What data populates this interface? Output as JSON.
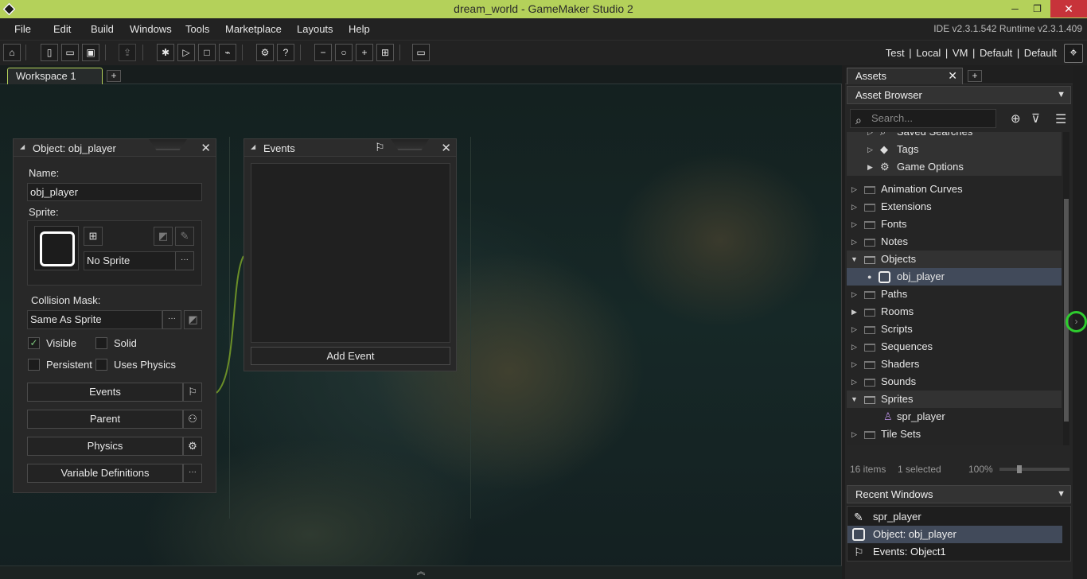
{
  "window": {
    "title": "dream_world - GameMaker Studio 2",
    "minimize": "─",
    "restore": "❐",
    "close": "✕"
  },
  "menu": {
    "items": [
      "File",
      "Edit",
      "Build",
      "Windows",
      "Tools",
      "Marketplace",
      "Layouts",
      "Help"
    ],
    "version": "IDE v2.3.1.542  Runtime v2.3.1.409"
  },
  "toolbar": {
    "target": "Test | Local | VM | Default | Default"
  },
  "workspace": {
    "tab": "Workspace 1",
    "add_tab": "+"
  },
  "object_editor": {
    "title": "Object: obj_player",
    "name_label": "Name:",
    "name_value": "obj_player",
    "sprite_label": "Sprite:",
    "sprite_value": "No Sprite",
    "mask_label": "Collision Mask:",
    "mask_value": "Same As Sprite",
    "more": "···",
    "checks": {
      "visible": "Visible",
      "solid": "Solid",
      "persistent": "Persistent",
      "physics": "Uses Physics"
    },
    "visible_checked": true,
    "buttons": {
      "events": "Events",
      "parent": "Parent",
      "physics": "Physics",
      "vars": "Variable Definitions"
    }
  },
  "events_editor": {
    "title": "Events",
    "add_event": "Add Event"
  },
  "assets": {
    "tab": "Assets",
    "add_tab": "+",
    "browser": "Asset Browser",
    "search_placeholder": "Search...",
    "tree": [
      {
        "label": "Saved Searches",
        "kind": "search"
      },
      {
        "label": "Tags",
        "kind": "tag"
      },
      {
        "label": "Game Options",
        "kind": "gear"
      },
      {
        "label": "Animation Curves",
        "kind": "folder"
      },
      {
        "label": "Extensions",
        "kind": "folder"
      },
      {
        "label": "Fonts",
        "kind": "folder"
      },
      {
        "label": "Notes",
        "kind": "folder"
      },
      {
        "label": "Objects",
        "kind": "folder-open"
      },
      {
        "label": "obj_player",
        "kind": "object"
      },
      {
        "label": "Paths",
        "kind": "folder"
      },
      {
        "label": "Rooms",
        "kind": "folder"
      },
      {
        "label": "Scripts",
        "kind": "folder"
      },
      {
        "label": "Sequences",
        "kind": "folder"
      },
      {
        "label": "Shaders",
        "kind": "folder"
      },
      {
        "label": "Sounds",
        "kind": "folder"
      },
      {
        "label": "Sprites",
        "kind": "folder-open"
      },
      {
        "label": "spr_player",
        "kind": "sprite"
      },
      {
        "label": "Tile Sets",
        "kind": "folder"
      }
    ],
    "status_items": "16 items",
    "status_selected": "1 selected",
    "zoom": "100%",
    "recent_label": "Recent Windows",
    "recent": [
      "spr_player",
      "Object: obj_player",
      "Events: Object1"
    ]
  },
  "colors": {
    "accent": "#b4d15a",
    "selection": "#414a5a",
    "highlight_ring": "#2ecc2e"
  }
}
